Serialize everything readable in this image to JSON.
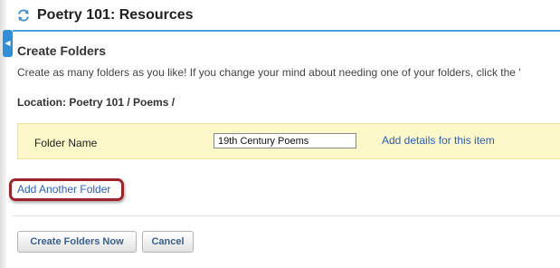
{
  "header": {
    "title": "Poetry 101: Resources",
    "icon": "reset-arrows-icon",
    "accent_color": "#4a9fe0"
  },
  "sidebar_toggle": {
    "icon": "chevron-left-icon",
    "color": "#2f8fd8"
  },
  "section": {
    "title": "Create Folders",
    "instructions": "Create as many folders as you like! If you change your mind about needing one of your folders, click the '",
    "location": "Location: Poetry 101 / Poems /"
  },
  "folder_row": {
    "label": "Folder Name",
    "value": "19th Century Poems",
    "details_link": "Add details for this item",
    "background": "#fcf8c9"
  },
  "add_another": {
    "label": "Add Another Folder",
    "highlight_color": "#a0232b"
  },
  "buttons": {
    "create": "Create Folders Now",
    "cancel": "Cancel"
  }
}
